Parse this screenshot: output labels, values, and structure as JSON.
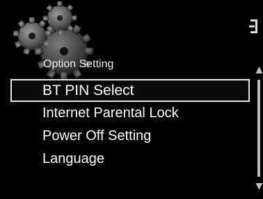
{
  "menu": {
    "title": "Option Setting",
    "items": [
      {
        "label": "BT PIN Select",
        "selected": true
      },
      {
        "label": "Internet Parental Lock",
        "selected": false
      },
      {
        "label": "Power Off Setting",
        "selected": false
      },
      {
        "label": "Language",
        "selected": false
      }
    ]
  },
  "icons": {
    "header": "gears-icon",
    "corner": "input-bracket-icon",
    "scroll_up": "scroll-up-arrow-icon",
    "scroll_down": "scroll-down-arrow-icon"
  },
  "colors": {
    "background": "#000000",
    "text": "#ffffff",
    "selection_border": "#e6e6e6",
    "gear": "#6e6e6e",
    "scrollbar": "#bdbdbd"
  }
}
